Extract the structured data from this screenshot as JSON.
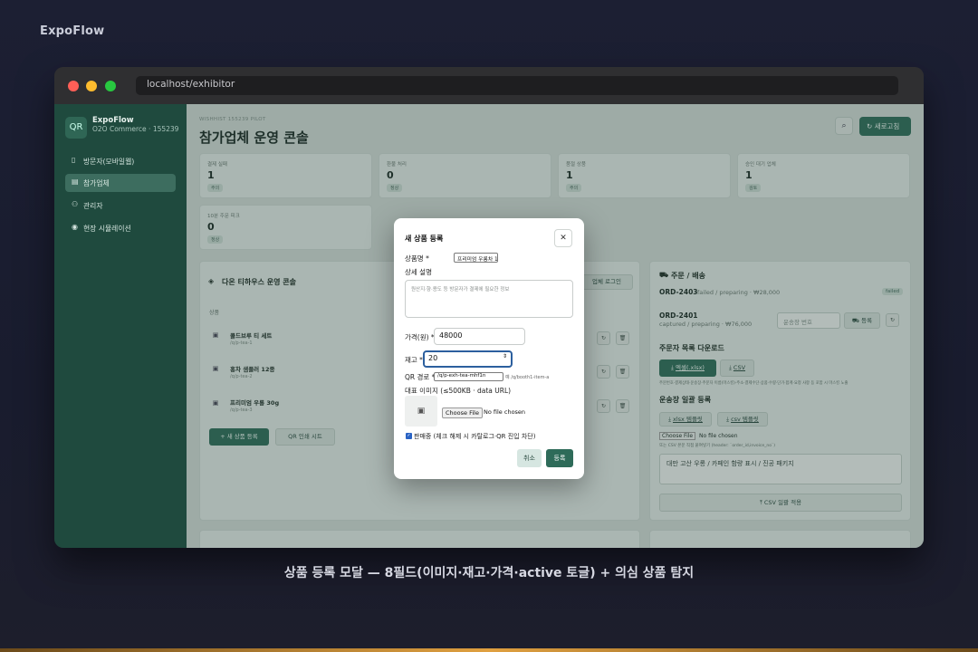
{
  "brand": "ExpoFlow",
  "caption": "상품 등록 모달 — 8필드(이미지·재고·가격·active 토글) + 의심 상품 탐지",
  "browser": {
    "url": "localhost/exhibitor"
  },
  "sidebar": {
    "logo_text": "QR",
    "app_name": "ExpoFlow",
    "app_sub": "O2O Commerce · 155239",
    "items": [
      {
        "label": "방문자(모바일웹)"
      },
      {
        "label": "참가업체"
      },
      {
        "label": "관리자"
      },
      {
        "label": "현장 시뮬레이션"
      }
    ]
  },
  "header": {
    "eyebrow": "WISHHIST 155239 PILOT",
    "title": "참가업체 운영 콘솔",
    "refresh_label": "새로고침"
  },
  "stats": [
    {
      "label": "결제 실패",
      "value": "1",
      "tag": "주의"
    },
    {
      "label": "환불 처리",
      "value": "0",
      "tag": "정상"
    },
    {
      "label": "품절 상품",
      "value": "1",
      "tag": "주의"
    },
    {
      "label": "승인 대기 업체",
      "value": "1",
      "tag": "검토"
    },
    {
      "label": "10분 주문 피크",
      "value": "0",
      "tag": "정상"
    }
  ],
  "products_panel": {
    "title": "다온 티하우스 운영 콘솔",
    "col_header": "상품",
    "login_btn": "업체 로그인",
    "rows": [
      {
        "name": "콜드브루 티 세트",
        "path": "/q/p-tea-1"
      },
      {
        "name": "홍차 샘플러 12종",
        "path": "/q/p-tea-2"
      },
      {
        "name": "프리미엄 우롱 30g",
        "path": "/q/p-tea-3"
      }
    ],
    "add_btn": "+ 새 상품 등록",
    "qr_btn": "QR 인쇄 시트"
  },
  "orders_panel": {
    "title": "주문 / 배송",
    "orders": [
      {
        "id": "ORD-2403",
        "meta": "failed / preparing · ₩28,000",
        "badge": "failed"
      },
      {
        "id": "ORD-2401",
        "meta": "captured / preparing · ₩76,000"
      }
    ],
    "tracking_placeholder": "운송장 번호",
    "register_btn": "등록",
    "download_title": "주문자 목록 다운로드",
    "excel_btn": "엑셀(.xlsx)",
    "csv_btn": "CSV",
    "download_note": "주문번호·결제상태·운송장·주문자 이름(마스킹)·주소·결제수단·상품·수량·단가·합계·요청 사항 등 포함 시 마스킹 노출",
    "bulk_title": "운송장 일괄 등록",
    "xlsx_tpl": "xlsx 템플릿",
    "csv_tpl": "csv 템플릿",
    "file_btn": "Choose File",
    "file_status": "No file chosen",
    "bulk_note": "또는 CSV 본문 직접 붙여넣기 (header: `order_id,invoice_no`)",
    "textarea_value": "대만 고산 우롱 / 카페인 함량 표시 / 진공 패키지",
    "apply_btn": "CSV 일괄 적용"
  },
  "modal": {
    "title": "새 상품 등록",
    "name_label": "상품명 *",
    "name_value": "프리미엄 우롱차 100g",
    "desc_label": "상세 설명",
    "desc_placeholder": "원산지·향·용도 등 방문자가 결제에 필요한 정보",
    "price_label": "가격(원) *",
    "price_value": "48000",
    "stock_label": "재고 *",
    "stock_value": "20",
    "qr_label": "QR 경로 *",
    "qr_value": "/q/p-exh-tea-mhf1n",
    "qr_hint": "예 /q/booth1-item-a",
    "image_label": "대표 이미지 (≤500KB · data URL)",
    "file_btn": "Choose File",
    "file_status": "No file chosen",
    "active_label": "판매중 (체크 해제 시 카탈로그·QR 진입 차단)",
    "cancel_btn": "취소",
    "submit_btn": "등록"
  }
}
